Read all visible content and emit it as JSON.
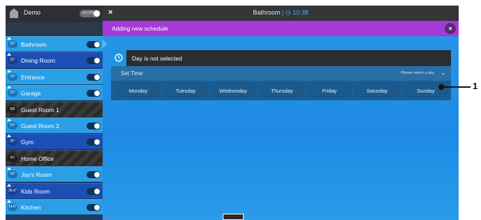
{
  "sidebar": {
    "title": "Demo",
    "toggle_text": "All OFF",
    "rooms": [
      {
        "badge": "22°",
        "name": "Bathroom",
        "style": "light",
        "switch": true
      },
      {
        "badge": "21°",
        "name": "Dining Room",
        "style": "dark",
        "switch": true
      },
      {
        "badge": "19°",
        "name": "Entrance",
        "style": "light",
        "switch": true
      },
      {
        "badge": "23°",
        "name": "Garage",
        "style": "light",
        "switch": true
      },
      {
        "badge": "M2",
        "name": "Guest Room 1",
        "style": "stripe",
        "switch": false
      },
      {
        "badge": "14°",
        "name": "Guest Room 2",
        "style": "light",
        "switch": true
      },
      {
        "badge": "25°",
        "name": "Gym",
        "style": "dark",
        "switch": true
      },
      {
        "badge": "H7",
        "name": "Home Office",
        "style": "stripe",
        "switch": false
      },
      {
        "badge": "16°",
        "name": "Joy's Room",
        "style": "light",
        "switch": true
      },
      {
        "badge": "26.6°",
        "name": "Kids Room",
        "style": "dark",
        "switch": true
      },
      {
        "badge": "14.6°",
        "name": "Kitchen",
        "style": "light",
        "switch": true
      }
    ]
  },
  "topbar": {
    "close": "×",
    "title": "Bathroom",
    "time": "10:38"
  },
  "banner": {
    "text": "Adding new schedule",
    "close": "×"
  },
  "card": {
    "title": "Day is not selected",
    "set_time": "Set Time",
    "hint": "Please select a day",
    "chevron": "⌄",
    "days": [
      "Monday",
      "Tuesday",
      "Wednesday",
      "Thursday",
      "Friday",
      "Saturday",
      "Sunday"
    ]
  },
  "callout": {
    "number": "1"
  }
}
